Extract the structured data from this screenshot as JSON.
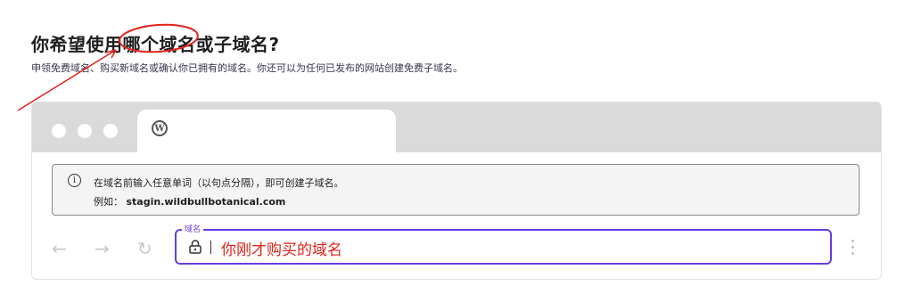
{
  "page": {
    "title": "你希望使用哪个域名或子域名?",
    "subtitle": "申领免费域名、购买新域名或确认你已拥有的域名。你还可以为任何已发布的网站创建免费子域名。"
  },
  "browser": {
    "tab_icon": "wordpress-icon",
    "info": {
      "line1": "在域名前输入任意单词（以句点分隔），即可创建子域名。",
      "example_label": "例如：",
      "example_value": "stagin.wildbullbotanical.com"
    },
    "nav_icons": [
      "back-arrow-icon",
      "forward-arrow-icon",
      "reload-icon"
    ],
    "field": {
      "label": "域名",
      "value": "你刚才购买的域名"
    }
  },
  "colors": {
    "accent": "#673de6",
    "annotation": "#e0231b",
    "tab_bar": "#dadada"
  }
}
